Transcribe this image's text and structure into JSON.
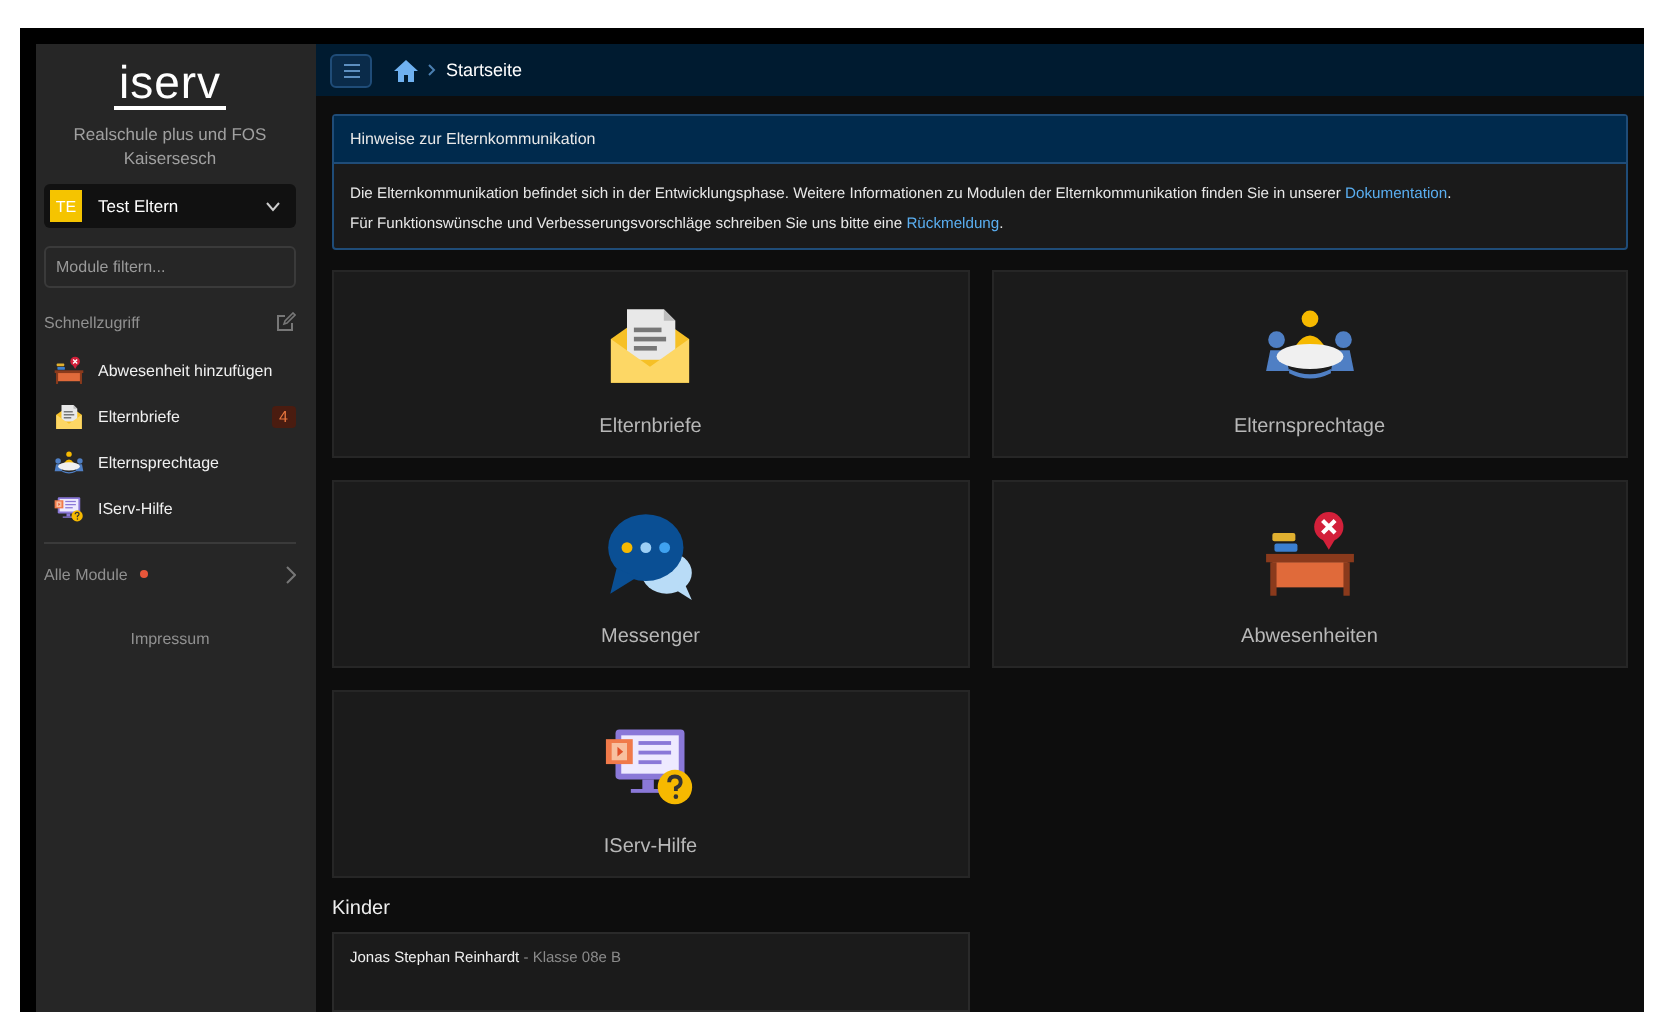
{
  "brand": {
    "logo": "iserv",
    "school": "Realschule plus und FOS Kaisersesch"
  },
  "user": {
    "initials": "TE",
    "name": "Test Eltern"
  },
  "filter": {
    "placeholder": "Module filtern..."
  },
  "quick_access": {
    "title": "Schnellzugriff",
    "items": [
      {
        "label": "Abwesenheit hinzufügen",
        "kind": "desk"
      },
      {
        "label": "Elternbriefe",
        "kind": "letter",
        "badge": "4"
      },
      {
        "label": "Elternsprechtage",
        "kind": "meeting"
      },
      {
        "label": "IServ-Hilfe",
        "kind": "help"
      }
    ]
  },
  "all_modules": {
    "label": "Alle Module",
    "notification": true
  },
  "footer_link": "Impressum",
  "breadcrumb": "Startseite",
  "notice": {
    "title": "Hinweise zur Elternkommunikation",
    "paragraphs": [
      {
        "text": "Die Elternkommunikation befindet sich in der Entwicklungsphase. Weitere Informationen zu Modulen der Elternkommunikation finden Sie in unserer ",
        "link": "Dokumentation",
        "after": "."
      },
      {
        "text": "Für Funktionswünsche und Verbesserungsvorschläge schreiben Sie uns bitte eine ",
        "link": "Rückmeldung",
        "after": "."
      }
    ]
  },
  "tiles": [
    {
      "label": "Elternbriefe",
      "kind": "letter"
    },
    {
      "label": "Elternsprechtage",
      "kind": "meeting"
    },
    {
      "label": "Messenger",
      "kind": "chat"
    },
    {
      "label": "Abwesenheiten",
      "kind": "desk"
    },
    {
      "label": "IServ-Hilfe",
      "kind": "help"
    }
  ],
  "children_section": {
    "title": "Kinder",
    "children": [
      {
        "name": "Jonas Stephan Reinhardt",
        "detail": "- Klasse 08e B"
      }
    ]
  }
}
